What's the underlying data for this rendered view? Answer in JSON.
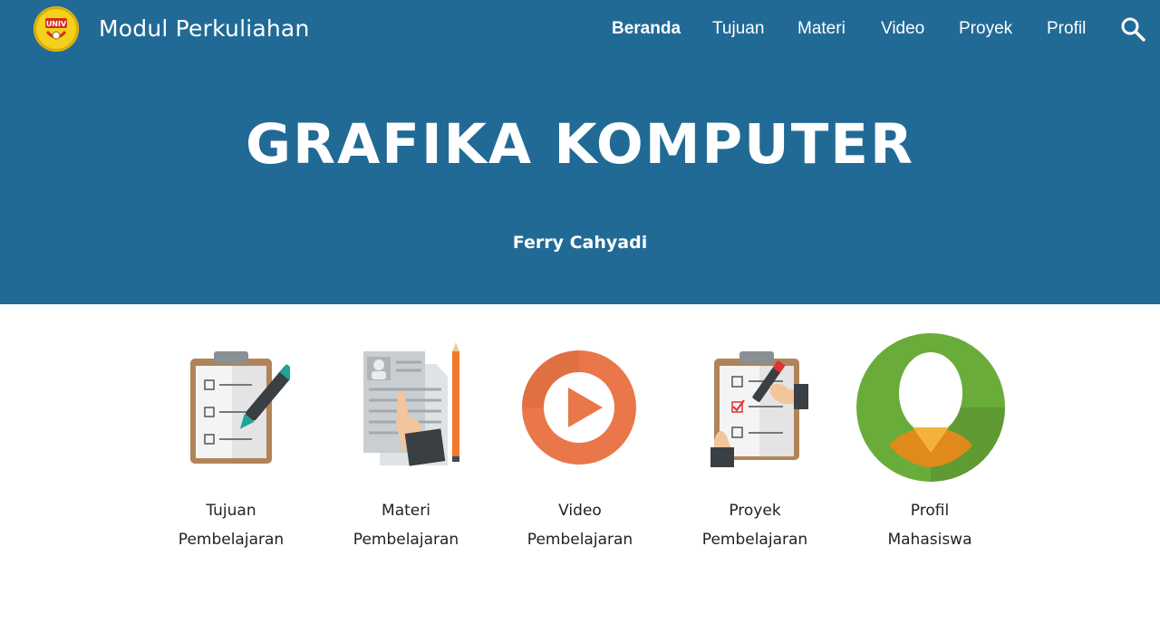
{
  "header": {
    "site_title": "Modul Perkuliahan",
    "logo_icon": "university-logo-icon",
    "search_icon": "search-icon",
    "background_color": "#216a96"
  },
  "nav": {
    "items": [
      "Beranda",
      "Tujuan",
      "Materi",
      "Video",
      "Proyek",
      "Profil"
    ],
    "active": "Beranda"
  },
  "hero": {
    "title": "GRAFIKA KOMPUTER",
    "author": "Ferry Cahyadi"
  },
  "cards": [
    {
      "icon": "clipboard-pen-icon",
      "line1": "Tujuan",
      "line2": "Pembelajaran"
    },
    {
      "icon": "document-pencil-icon",
      "line1": "Materi",
      "line2": "Pembelajaran"
    },
    {
      "icon": "play-icon",
      "line1": "Video",
      "line2": "Pembelajaran"
    },
    {
      "icon": "checklist-icon",
      "line1": "Proyek",
      "line2": "Pembelajaran"
    },
    {
      "icon": "user-profile-icon",
      "line1": "Profil",
      "line2": "Mahasiswa"
    }
  ]
}
